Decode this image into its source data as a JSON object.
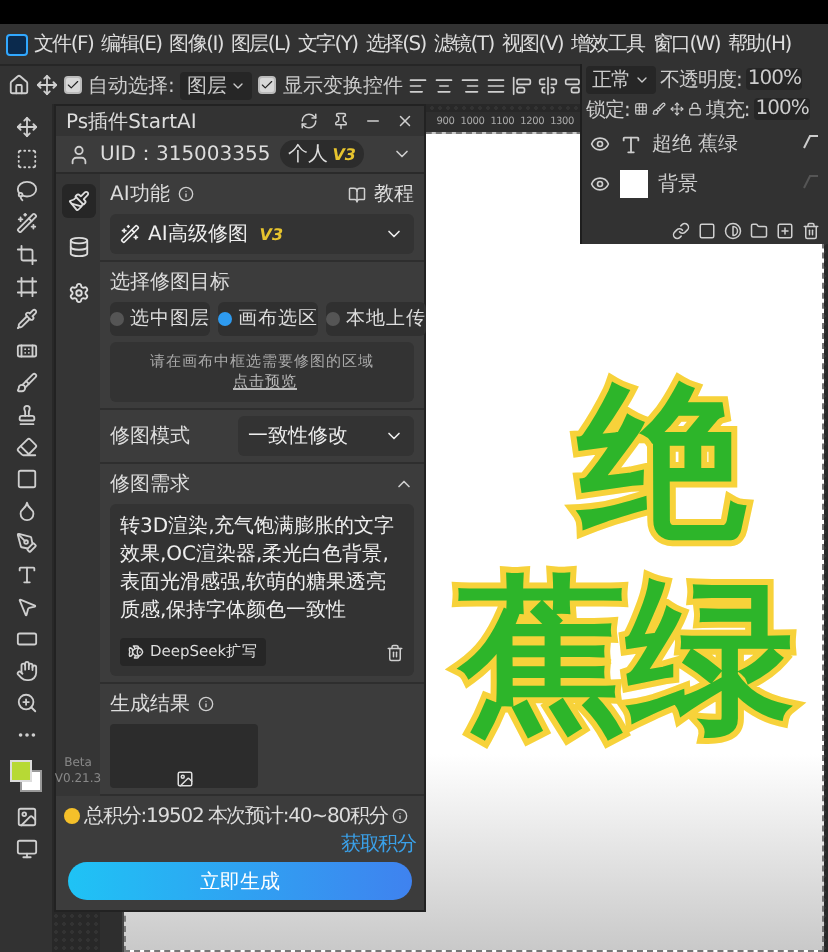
{
  "menubar": {
    "items": [
      "文件(F)",
      "编辑(E)",
      "图像(I)",
      "图层(L)",
      "文字(Y)",
      "选择(S)",
      "滤镜(T)",
      "视图(V)",
      "增效工具",
      "窗口(W)",
      "帮助(H)"
    ]
  },
  "options_bar": {
    "auto_select": {
      "label": "自动选择:",
      "checked": true
    },
    "target": "图层",
    "show_transform": {
      "label": "显示变换控件",
      "checked": true
    }
  },
  "layers_panel": {
    "blend_mode": "正常",
    "opacity_label": "不透明度:",
    "opacity": "100%",
    "lock_label": "锁定:",
    "fill_label": "填充:",
    "fill": "100%",
    "layers": [
      {
        "kind": "text",
        "name": "超绝 蕉绿",
        "visible": true,
        "has_fx": true
      },
      {
        "kind": "image",
        "name": "背景",
        "visible": true,
        "has_fx": false
      }
    ]
  },
  "ruler": {
    "marks": [
      "900",
      "1000",
      "1100",
      "1200",
      "1300"
    ]
  },
  "canvas": {
    "lines": [
      "绝",
      "蕉绿"
    ]
  },
  "plugin": {
    "title": "Ps插件StartAI",
    "uid": "UID：315003355",
    "plan": "个人",
    "plan_level": "V3",
    "rail": [
      {
        "kind": "brush",
        "selected": true
      },
      {
        "kind": "database",
        "selected": false
      },
      {
        "kind": "settings",
        "selected": false
      }
    ],
    "version": [
      "Beta",
      "V0.21.3"
    ],
    "ai_label": "AI功能",
    "tutorial": "教程",
    "feature": "AI高级修图",
    "feature_level": "V3",
    "target_label": "选择修图目标",
    "targets": [
      {
        "label": "选中图层",
        "selected": false
      },
      {
        "label": "画布选区",
        "selected": true
      },
      {
        "label": "本地上传",
        "selected": false
      }
    ],
    "hint": "请在画布中框选需要修图的区域",
    "hint_link": "点击预览",
    "mode_label": "修图模式",
    "mode": "一致性修改",
    "prompt_label": "修图需求",
    "prompt_expanded": true,
    "prompt": "转3D渲染,充气饱满膨胀的文字效果,OC渲染器,柔光白色背景,表面光滑感强,软萌的糖果透亮质感,保持字体颜色一致性",
    "expand_button": "DeepSeek扩写",
    "result_label": "生成结果",
    "points": "总积分:19502",
    "estimate": "本次预计:40~80积分",
    "get_points": "获取积分",
    "generate": "立即生成"
  }
}
